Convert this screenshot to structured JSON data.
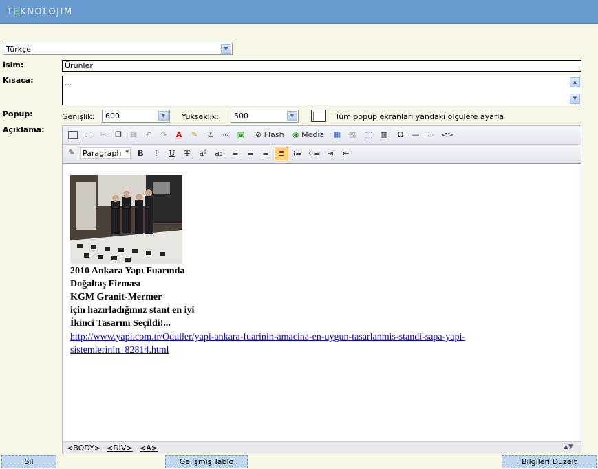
{
  "header": {
    "logo_t": "T",
    "logo_e": "E",
    "logo_rest": "KNOLOJIM"
  },
  "language": {
    "selected": "Türkçe"
  },
  "labels": {
    "isim": "İsim:",
    "kisaca": "Kısaca:",
    "popup": "Popup:",
    "aciklama": "Açıklama:"
  },
  "fields": {
    "isim_value": "Ürünler",
    "kisaca_value": "..."
  },
  "popup": {
    "genislik_label": "Genişlik:",
    "genislik_value": "600",
    "yukseklik_label": "Yükseklik:",
    "yukseklik_value": "500",
    "checkbox_label": "Tüm popup ekranları yandaki ölçülere ayarla"
  },
  "toolbar": {
    "flash": "Flash",
    "media": "Media",
    "paragraph": "Paragraph",
    "ohm": "Ω",
    "code": "<>"
  },
  "editor": {
    "lines": [
      "2010 Ankara Yapı Fuarında",
      "Doğaltaş Firması",
      "KGM Granit-Mermer",
      "için hazırladığımız stant en iyi",
      "İkinci Tasarım Seçildi!..."
    ],
    "link": "http://www.yapi.com.tr/Oduller/yapi-ankara-fuarinin-amacina-en-uygun-tasarlanmis-standi-sapa-yapi-sistemlerinin_82814.html",
    "path_body": "<BODY>",
    "path_div": "<DIV>",
    "path_a": "<A>"
  },
  "buttons": {
    "sil": "Sil",
    "gelismis": "Gelişmiş Tablo",
    "duzelt": "Bilgileri Düzelt"
  },
  "colors": {
    "header": "#6a9bd0",
    "background": "#f7f6e7",
    "button": "#bfd7ee",
    "link": "#0000cc"
  }
}
